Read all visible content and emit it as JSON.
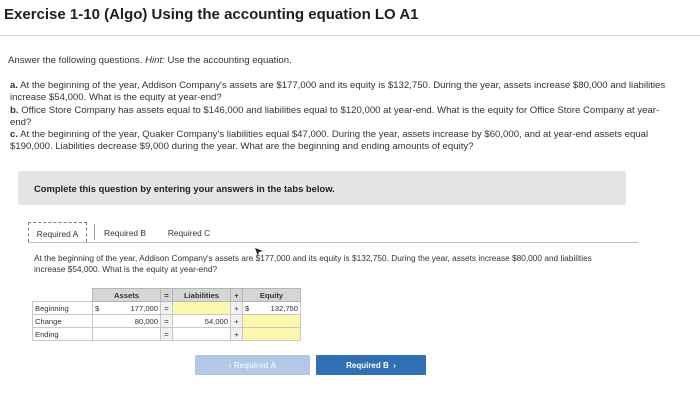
{
  "title": "Exercise 1-10 (Algo) Using the accounting equation LO A1",
  "instructions": {
    "lead": "Answer the following questions.",
    "hint_label": "Hint:",
    "hint_text": "Use the accounting equation."
  },
  "questions": [
    {
      "letter": "a.",
      "text": "At the beginning of the year, Addison Company's assets are $177,000 and its equity is $132,750. During the year, assets increase $80,000 and liabilities increase $54,000. What is the equity at year-end?"
    },
    {
      "letter": "b.",
      "text": "Office Store Company has assets equal to $146,000 and liabilities equal to $120,000 at year-end. What is the equity for Office Store Company at year-end?"
    },
    {
      "letter": "c.",
      "text": "At the beginning of the year, Quaker Company's liabilities equal $47,000. During the year, assets increase by $60,000, and at year-end assets equal $190,000. Liabilities decrease $9,000 during the year. What are the beginning and ending amounts of equity?"
    }
  ],
  "banner": "Complete this question by entering your answers in the tabs below.",
  "tabs": [
    "Required A",
    "Required B",
    "Required C"
  ],
  "prompt": "At the beginning of the year, Addison Company's assets are $177,000 and its equity is $132,750. During the year, assets increase $80,000 and liabilities increase $54,000. What is the equity at year-end?",
  "table": {
    "headers": {
      "assets": "Assets",
      "eq": "=",
      "liabilities": "Liabilities",
      "plus": "+",
      "equity": "Equity"
    },
    "rows": [
      {
        "label": "Beginning",
        "dollar": "$",
        "assets": "177,000",
        "op1": "=",
        "liabilities": "",
        "op2": "+",
        "eq_dollar": "$",
        "equity": "132,750"
      },
      {
        "label": "Change",
        "dollar": "",
        "assets": "80,000",
        "op1": "=",
        "liabilities": "54,000",
        "op2": "+",
        "eq_dollar": "",
        "equity": ""
      },
      {
        "label": "Ending",
        "dollar": "",
        "assets": "",
        "op1": "=",
        "liabilities": "",
        "op2": "+",
        "eq_dollar": "",
        "equity": ""
      }
    ]
  },
  "nav": {
    "prev_label": "Required A",
    "next_label": "Required B"
  },
  "colors": {
    "accent": "#2f6fb3",
    "banner": "#e5e5e5",
    "answer_cell": "#fdf7ad"
  }
}
